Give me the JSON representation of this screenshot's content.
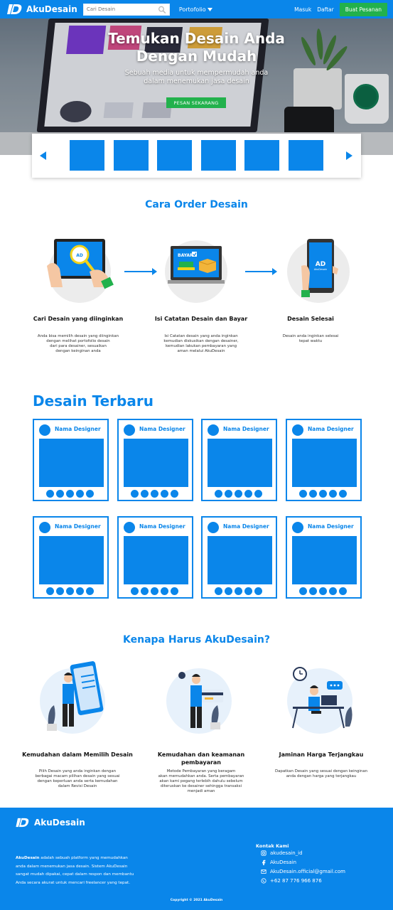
{
  "nav": {
    "brand": "AkuDesain",
    "search_placeholder": "Cari Desain",
    "portfolio": "Portofolio",
    "login": "Masuk",
    "register": "Daftar",
    "order_btn": "Buat Pesanan"
  },
  "hero": {
    "title_line1": "Temukan Desain Anda",
    "title_line2": "Dengan Mudah",
    "sub_line1": "Sebuah media untuk mempermudah anda",
    "sub_line2": "dalam menemukan jasa desain",
    "cta": "PESAN SEKARANG"
  },
  "how": {
    "title": "Cara Order Desain",
    "steps": [
      {
        "title": "Cari Desain yang diinginkan",
        "desc": [
          "Anda bisa memilih desain yang diinginkan",
          "dengan melihat portofolio desain",
          "dari para desainer, sesuaikan",
          "dengan keinginan anda"
        ]
      },
      {
        "title": "Isi Catatan Desain dan Bayar",
        "desc": [
          "Isi Catatan desain yang anda inginkan",
          "kemudian diskusikan dengan desainer,",
          "kemudian lakukan pembayaran yang",
          "aman melalui AkuDesain"
        ]
      },
      {
        "title": "Desain Selesai",
        "desc": [
          "Desain anda inginkan selesai",
          "tepat waktu"
        ]
      }
    ],
    "pay_label": "BAYAR"
  },
  "latest": {
    "title": "Desain Terbaru",
    "designer": "Nama Designer"
  },
  "why": {
    "title": "Kenapa Harus AkuDesain?",
    "items": [
      {
        "title1": "Kemudahan dalam Memilih Desain",
        "title2": "",
        "desc": [
          "Pilih Desain yang anda inginkan dengan",
          "berbagai  macam pilihan desain yang sesuai",
          "dengan keperluan anda  serta kemudahan",
          "dalam Revisi Desain"
        ]
      },
      {
        "title1": "Kemudahan dan keamanan",
        "title2": "pembayaran",
        "desc": [
          "Metode Pembayaran yang beragam",
          "akan  memudahkan anda. Serta pembayaran",
          "akan kami pegang  terlebih dahulu sebelum",
          "diteruskan ke desainer sehingga transaksi",
          "menjadi aman"
        ]
      },
      {
        "title1": "Jaminan Harga Terjangkau",
        "title2": "",
        "desc": [
          "Dapatkan Desain yang sesuai dengan keinginan",
          "anda dengan harga yang terjangkau"
        ]
      }
    ]
  },
  "footer": {
    "brand": "AkuDesain",
    "desc_brand": "AkuDesain",
    "desc_line1": " adalah sebuah platform yang memudahkan",
    "desc_line2": "anda dalam menemukan jasa desain.  Sistem AkuDesain",
    "desc_line3": "sangat mudah dipakai, cepat dalam respon dan membantu",
    "desc_line4": "Anda secara akurat untuk mencari freelancer yang tepat.",
    "contact_title": "Kontak Kami",
    "instagram": "akudesain_id",
    "facebook": "AkuDesain",
    "email": "AkuDesain.official@gmail.com",
    "phone": "+62 87 776 966 876",
    "copyright": "Copyright © 2021 AkuDesain"
  },
  "colors": {
    "primary": "#0a86ea",
    "accent_green": "#22b14c"
  }
}
